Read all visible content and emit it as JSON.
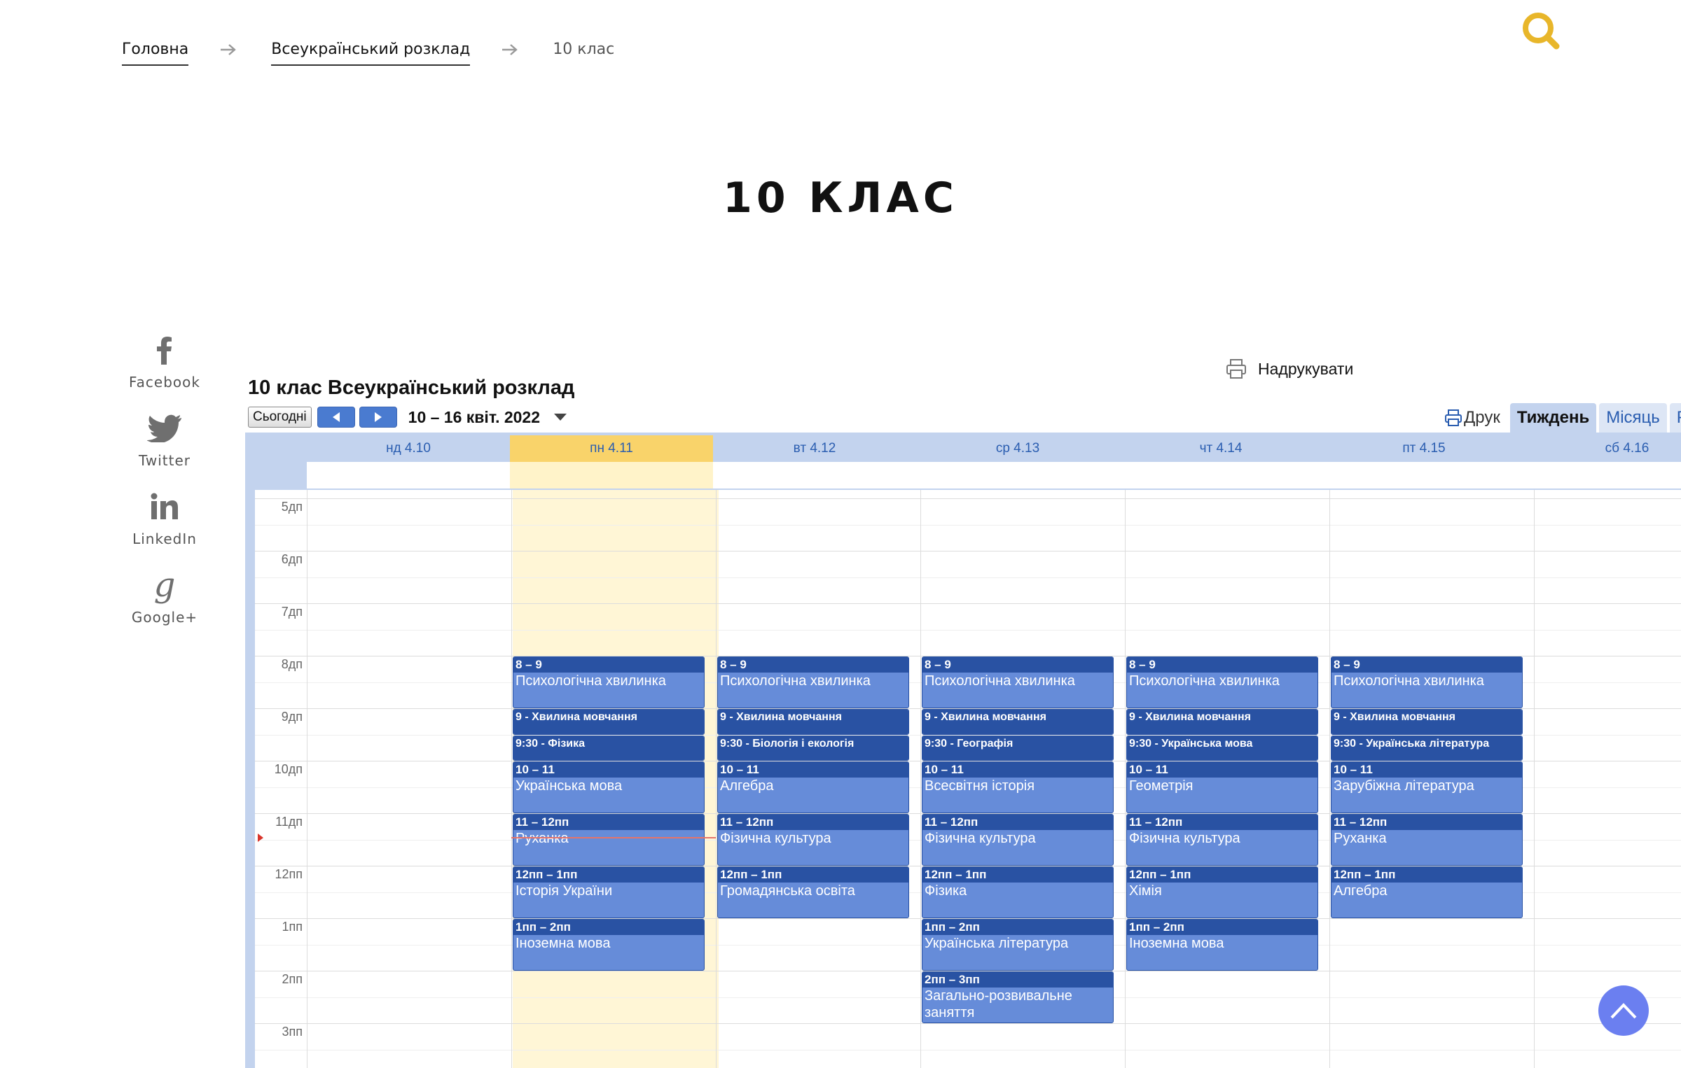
{
  "breadcrumb": {
    "home": "Головна",
    "parent": "Всеукраїнський розклад",
    "current": "10 клас"
  },
  "page": {
    "title": "10 КЛАС"
  },
  "share": [
    {
      "label": "Facebook",
      "icon": "facebook-icon"
    },
    {
      "label": "Twitter",
      "icon": "twitter-icon"
    },
    {
      "label": "LinkedIn",
      "icon": "linkedin-icon"
    },
    {
      "label": "Google+",
      "icon": "google-plus-icon"
    }
  ],
  "print_label": "Надрукувати",
  "calendar": {
    "title": "10 клас Всеукраїнський розклад",
    "today_button": "Сьогодні",
    "range": "10 – 16 квіт. 2022",
    "tabs": {
      "print": "Друк",
      "week": "Тиждень",
      "month": "Місяць",
      "next": "Р"
    },
    "days": [
      "нд 4.10",
      "пн 4.11",
      "вт 4.12",
      "ср 4.13",
      "чт 4.14",
      "пт 4.15",
      "сб 4.16"
    ],
    "hours": [
      "5дп",
      "6дп",
      "7дп",
      "8дп",
      "9дп",
      "10дп",
      "11дп",
      "12пп",
      "1пп",
      "2пп",
      "3пп"
    ],
    "events": {
      "mon": [
        {
          "time": "8 – 9",
          "title": "Психологічна хвилинка"
        },
        {
          "time": "9 - Хвилина мовчання"
        },
        {
          "time": "9:30 - Фізика"
        },
        {
          "time": "10 – 11",
          "title": "Українська мова"
        },
        {
          "time": "11 – 12пп",
          "title": "Руханка"
        },
        {
          "time": "12пп – 1пп",
          "title": "Історія України"
        },
        {
          "time": "1пп – 2пп",
          "title": "Іноземна мова"
        }
      ],
      "tue": [
        {
          "time": "8 – 9",
          "title": "Психологічна хвилинка"
        },
        {
          "time": "9 - Хвилина мовчання"
        },
        {
          "time": "9:30 - Біологія і екологія"
        },
        {
          "time": "10 – 11",
          "title": "Алгебра"
        },
        {
          "time": "11 – 12пп",
          "title": "Фізична культура"
        },
        {
          "time": "12пп – 1пп",
          "title": "Громадянська освіта"
        }
      ],
      "wed": [
        {
          "time": "8 – 9",
          "title": "Психологічна хвилинка"
        },
        {
          "time": "9 - Хвилина мовчання"
        },
        {
          "time": "9:30 - Географія"
        },
        {
          "time": "10 – 11",
          "title": "Всесвітня історія"
        },
        {
          "time": "11 – 12пп",
          "title": "Фізична культура"
        },
        {
          "time": "12пп – 1пп",
          "title": "Фізика"
        },
        {
          "time": "1пп – 2пп",
          "title": "Українська література"
        },
        {
          "time": "2пп – 3пп",
          "title": "Загально-розвивальне заняття"
        }
      ],
      "thu": [
        {
          "time": "8 – 9",
          "title": "Психологічна хвилинка"
        },
        {
          "time": "9 - Хвилина мовчання"
        },
        {
          "time": "9:30 - Українська мова"
        },
        {
          "time": "10 – 11",
          "title": "Геометрія"
        },
        {
          "time": "11 – 12пп",
          "title": "Фізична культура"
        },
        {
          "time": "12пп – 1пп",
          "title": "Хімія"
        },
        {
          "time": "1пп – 2пп",
          "title": "Іноземна мова"
        }
      ],
      "fri": [
        {
          "time": "8 – 9",
          "title": "Психологічна хвилинка"
        },
        {
          "time": "9 - Хвилина мовчання"
        },
        {
          "time": "9:30 - Українська література"
        },
        {
          "time": "10 – 11",
          "title": "Зарубіжна література"
        },
        {
          "time": "11 – 12пп",
          "title": "Руханка"
        },
        {
          "time": "12пп – 1пп",
          "title": "Алгебра"
        }
      ]
    }
  },
  "colors": {
    "event_bg": "#668cd9",
    "event_border": "#2952a3",
    "today_bg": "#fff6d6",
    "search_accent": "#e8b62a",
    "scroll_top": "#6b7ff0"
  }
}
